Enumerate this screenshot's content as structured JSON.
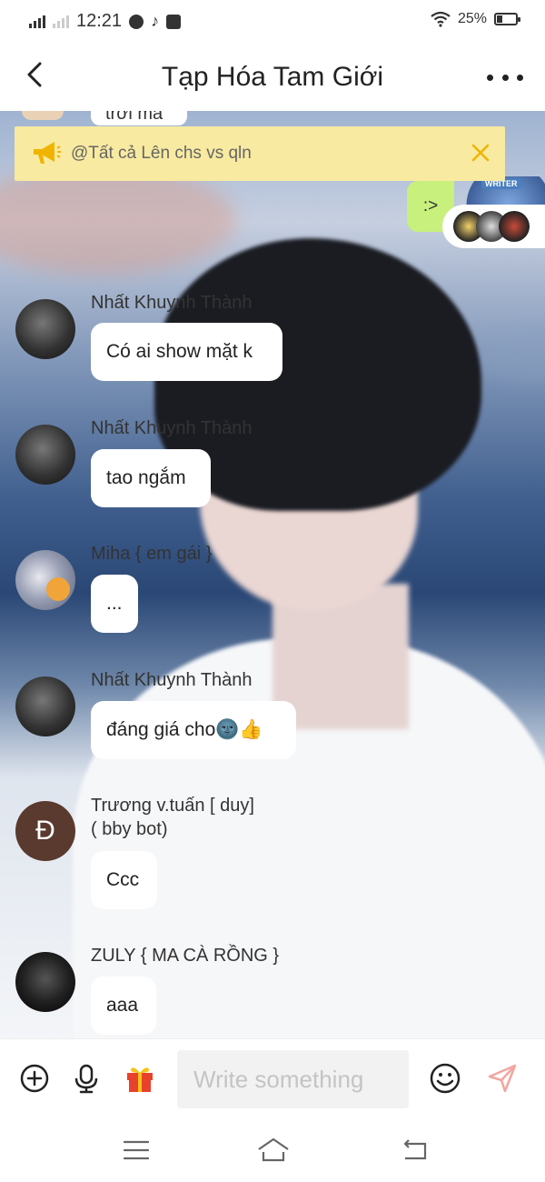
{
  "status_bar": {
    "time": "12:21",
    "battery_pct": "25%",
    "battery_level": 0.25
  },
  "header": {
    "title": "Tạp Hóa Tam Giới"
  },
  "chat": {
    "partial_top_text": "trời mà",
    "pinned_notice": "@Tất cả Lên chs vs qln",
    "outgoing_text": ":>",
    "writer_badge": "WRITER",
    "messages": [
      {
        "sender": "Nhất Khuynh Thành",
        "text": "Có ai show mặt k"
      },
      {
        "sender": "Nhất Khuynh Thành",
        "text": "tao ngắm"
      },
      {
        "sender": "Miha { em gái }",
        "text": "..."
      },
      {
        "sender": "Nhất Khuynh Thành",
        "text": "đáng giá cho🌚👍"
      },
      {
        "sender": "Trương v.tuấn [ duy]\n( bby bot)",
        "avatar_letter": "Đ",
        "text": "Ccc"
      },
      {
        "sender": "ZULY { MA CÀ RỒNG }",
        "text": "aaa"
      }
    ]
  },
  "input": {
    "placeholder": "Write something"
  },
  "icons": {
    "back": "back-arrow-icon",
    "more": "more-icon",
    "notice": "megaphone-icon",
    "close": "close-icon",
    "add": "plus-circle-icon",
    "mic": "microphone-icon",
    "gift": "gift-icon",
    "emoji": "emoji-icon",
    "send": "send-icon",
    "menu": "menu-icon",
    "home": "home-icon",
    "recents": "back-nav-icon"
  },
  "colors": {
    "notice_bg": "#f8eaa0",
    "outgoing_bubble": "#c7f07c",
    "notice_icon": "#f0b400",
    "send": "#f3a5a0"
  }
}
